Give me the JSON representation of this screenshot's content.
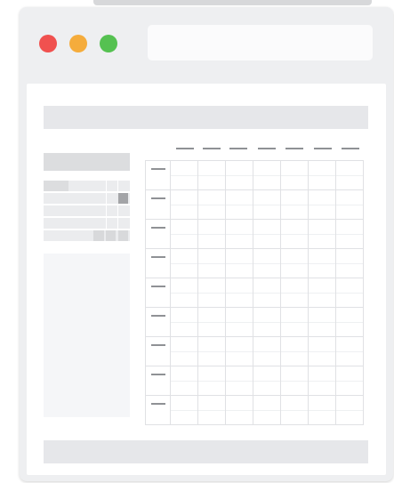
{
  "window": {
    "controls": [
      {
        "name": "close",
        "color": "#f0514f"
      },
      {
        "name": "minimize",
        "color": "#f5ac3c"
      },
      {
        "name": "maximize",
        "color": "#55c151"
      }
    ],
    "address_bar_value": ""
  },
  "colors": {
    "red": "#f0514f",
    "yellow": "#f5ac3c",
    "green": "#55c151"
  },
  "grid": {
    "columns": 7,
    "rows": 9
  }
}
